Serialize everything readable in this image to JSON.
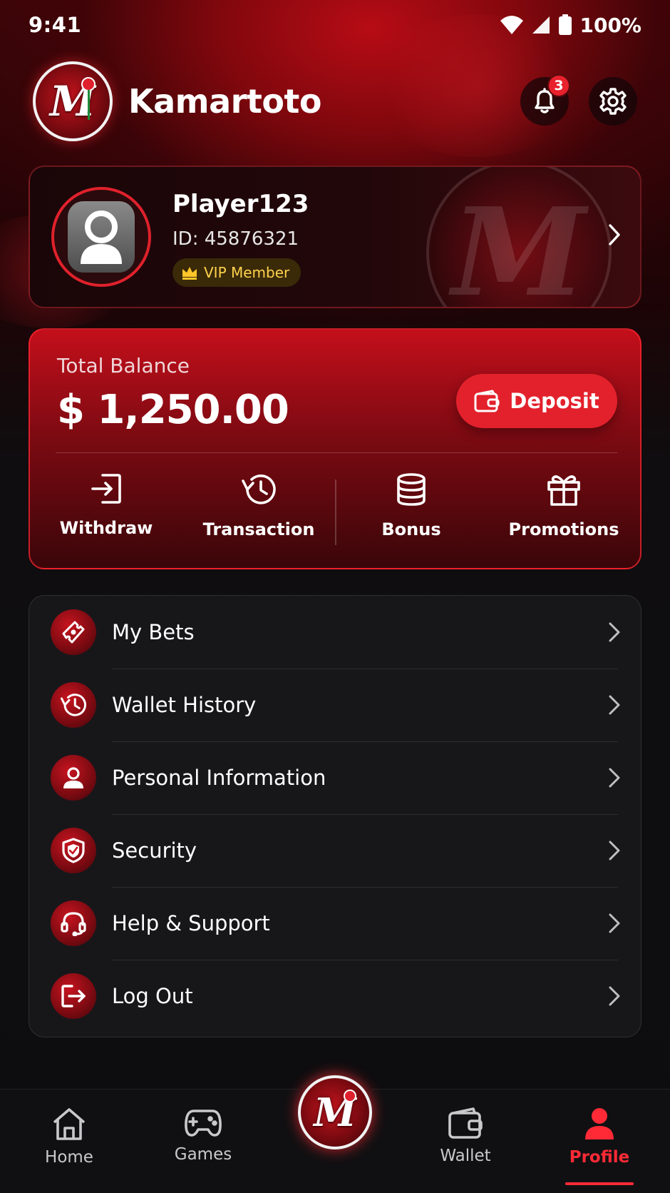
{
  "status_bar": {
    "time": "9:41",
    "battery": "100%"
  },
  "header": {
    "app_name": "Kamartoto",
    "logo_letter": "M",
    "notification_count": "3"
  },
  "profile": {
    "username": "Player123",
    "player_id": "ID: 45876321",
    "tier": "VIP Member"
  },
  "balance": {
    "label": "Total Balance",
    "amount": "$ 1,250.00",
    "deposit_label": "Deposit"
  },
  "quick_actions": [
    {
      "label": "Withdraw",
      "icon": "withdraw-icon"
    },
    {
      "label": "Transaction",
      "icon": "history-icon"
    },
    {
      "label": "Bonus",
      "icon": "coins-icon"
    },
    {
      "label": "Promotions",
      "icon": "gift-icon"
    }
  ],
  "menu": [
    {
      "label": "My Bets",
      "icon": "ticket-icon"
    },
    {
      "label": "Wallet History",
      "icon": "history-icon"
    },
    {
      "label": "Personal Information",
      "icon": "user-icon"
    },
    {
      "label": "Security",
      "icon": "shield-icon"
    },
    {
      "label": "Help & Support",
      "icon": "headset-icon"
    },
    {
      "label": "Log Out",
      "icon": "logout-icon"
    }
  ],
  "bottom_nav": [
    {
      "label": "Home",
      "icon": "home-icon"
    },
    {
      "label": "Games",
      "icon": "gamepad-icon"
    },
    {
      "label": "Wallet",
      "icon": "wallet-icon"
    },
    {
      "label": "Profile",
      "icon": "profile-icon",
      "active": true
    }
  ],
  "colors": {
    "accent": "#e3212c",
    "vip_gold": "#ffd24d",
    "background": "#0d0d0f"
  }
}
